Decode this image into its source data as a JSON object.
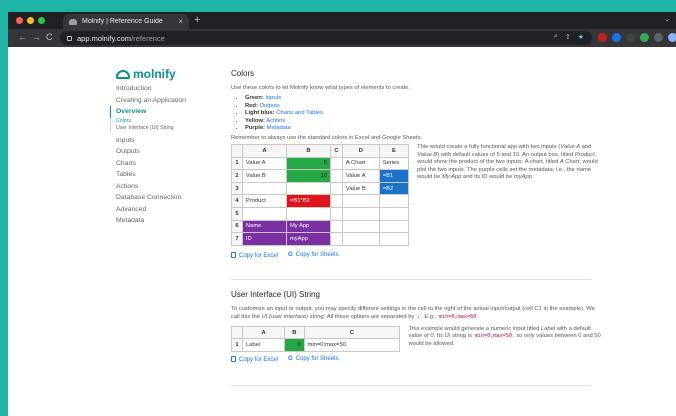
{
  "browser": {
    "tab_title": "Molnify | Reference Guide",
    "tab_close": "×",
    "new_tab": "+",
    "tab_menu": "⌄",
    "url_host": "app.molnify.com",
    "url_path": "/reference",
    "nav_back": "←",
    "nav_forward": "→",
    "nav_reload": "C"
  },
  "colors": {
    "brand": "#0a8f8f",
    "link": "#1a73e8",
    "green": "#27a844",
    "red": "#e0141d",
    "blue": "#1a73c9",
    "purple": "#7a2fa3"
  },
  "sidebar": {
    "logo": "molnify",
    "items_top": [
      "Introduction",
      "Creating an Application"
    ],
    "active": "Overview",
    "subitems": [
      "Colors",
      "User Interface (UI) String"
    ],
    "items_bottom": [
      "Inputs",
      "Outputs",
      "Charts",
      "Tables",
      "Actions",
      "Database Connection",
      "Advanced",
      "Metadata"
    ]
  },
  "colors_section": {
    "title": "Colors",
    "intro": "Use these colors to let Molnify know what types of elements to create.",
    "legend": [
      {
        "name": "Green:",
        "value": "Inputs"
      },
      {
        "name": "Red:",
        "value": "Outputs"
      },
      {
        "name": "Light blue:",
        "value": "Charts and Tables"
      },
      {
        "name": "Yellow:",
        "value": "Actions"
      },
      {
        "name": "Purple:",
        "value": "Metadata"
      }
    ],
    "reminder": "Remember to always use the standard colors in Excel and Google Sheets.",
    "columns": [
      "",
      "A",
      "B",
      "C",
      "D",
      "E"
    ],
    "rows": [
      [
        "1",
        "Value A",
        "5",
        "",
        "A Chart",
        "Series"
      ],
      [
        "2",
        "Value B",
        "10",
        "",
        "Value A",
        "=B1"
      ],
      [
        "3",
        "",
        "",
        "",
        "Value B",
        "=B2"
      ],
      [
        "4",
        "Product",
        "=B1*B2",
        "",
        "",
        ""
      ],
      [
        "5",
        "",
        "",
        "",
        "",
        ""
      ],
      [
        "6",
        "Name",
        "My App",
        "",
        "",
        ""
      ],
      [
        "7",
        "ID",
        "myApp",
        "",
        "",
        ""
      ]
    ],
    "description": [
      "This would create a fully functional app with two inputs (",
      "Value A",
      " and ",
      "Value B",
      ") with default values of 5 and 10. An output box, titled ",
      "Product",
      ", would show the product of the two inputs. A chart, titled ",
      "A Chart",
      ", would plot the two inputs. The purple cells set the metadata; i.e., the name would be ",
      "My App",
      " and its ID would be ",
      "myApp",
      "."
    ],
    "copy_excel": "Copy for Excel",
    "copy_sheets": "Copy for Sheets"
  },
  "ui_section": {
    "title": "User Interface (UI) String",
    "para_parts": [
      "To customize an input or output, you may specify different settings in the cell to the right of the actual input/output (cell C1 in the example). We call this the ",
      "UI (user interface) string",
      ". All these options are separated by ",
      ";",
      ". E.g., ",
      "min=0;max=50",
      "."
    ],
    "columns": [
      "",
      "A",
      "B",
      "C"
    ],
    "row": [
      "1",
      "Label",
      "0",
      "min=0;max=50"
    ],
    "description": [
      "This example would generate a numeric input titled ",
      "Label",
      " with a default value of ",
      "0",
      ". Its UI string is ",
      "min=0;max=50",
      ", so only values between 0 and 50 would be allowed."
    ],
    "copy_excel": "Copy for Excel",
    "copy_sheets": "Copy for Sheets"
  }
}
